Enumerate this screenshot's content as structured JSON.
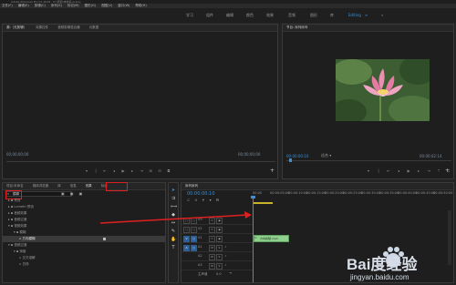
{
  "title_bar": "Adobe Premiere Pro CC 2019 - D:\\项目\\未命名.prproj",
  "menu": [
    "文件(F)",
    "编辑(E)",
    "剪辑(C)",
    "序列(S)",
    "标记(M)",
    "图形(G)",
    "视图(V)",
    "窗口(W)",
    "帮助(H)"
  ],
  "workspaces": [
    "学习",
    "组件",
    "编辑",
    "颜色",
    "效果",
    "音频",
    "图形",
    "库",
    "Editing"
  ],
  "workspace_active": "Editing",
  "source_panel": {
    "tabs": [
      "源:（无剪辑）",
      "效果控件",
      "音频剪辑混合器",
      "元数据"
    ],
    "timecode_left": "00;00;00;00",
    "timecode_right": "00;00;00;00"
  },
  "program_panel": {
    "tab": "节目: 序列序列",
    "timecode": "00:00:00:10",
    "fit_label": "适合",
    "duration": "00:00:02:14",
    "image_desc": "pink lotus flower"
  },
  "project_panel": {
    "tabs": [
      "项目:未命名",
      "媒体浏览器",
      "库",
      "信息",
      "效果",
      "标记"
    ],
    "active_tab": "效果",
    "search_value": "模糊",
    "tree": [
      {
        "label": "预设",
        "level": 0
      },
      {
        "label": "Lumetri 预设",
        "level": 0
      },
      {
        "label": "音频效果",
        "level": 0
      },
      {
        "label": "音频过渡",
        "level": 0
      },
      {
        "label": "视频效果",
        "level": 0
      },
      {
        "label": "模糊",
        "level": 1
      },
      {
        "label": "方向模糊",
        "level": 2
      },
      {
        "label": "视频过渡",
        "level": 0
      },
      {
        "label": "渐隐",
        "level": 1
      },
      {
        "label": "交叉溶解",
        "level": 2
      },
      {
        "label": "白场",
        "level": 2
      }
    ]
  },
  "timeline_panel": {
    "tab": "序列序列",
    "timecode": "00:00:00:10",
    "ruler": [
      "00:00",
      "00:00:05:00",
      "00:00:10:00",
      "00:00:15:00",
      "00:00:20:00",
      "00:00:25:00",
      "00:00:30:00",
      "00:00:35:00",
      "00:00:40:00",
      "00:00:45:00",
      "00:00:50:00"
    ],
    "video_tracks": [
      "V3",
      "V2",
      "V1"
    ],
    "audio_tracks": [
      "A1",
      "A2",
      "A3"
    ],
    "master_label": "主声道",
    "master_value": "0.0",
    "clip_label": "方向模糊.mp4"
  },
  "watermark": {
    "brand": "Bai度经验",
    "url": "jingyan.baidu.com"
  },
  "colors": {
    "accent": "#3d8fd6",
    "highlight": "#e02020",
    "clip": "#8fd08f"
  }
}
